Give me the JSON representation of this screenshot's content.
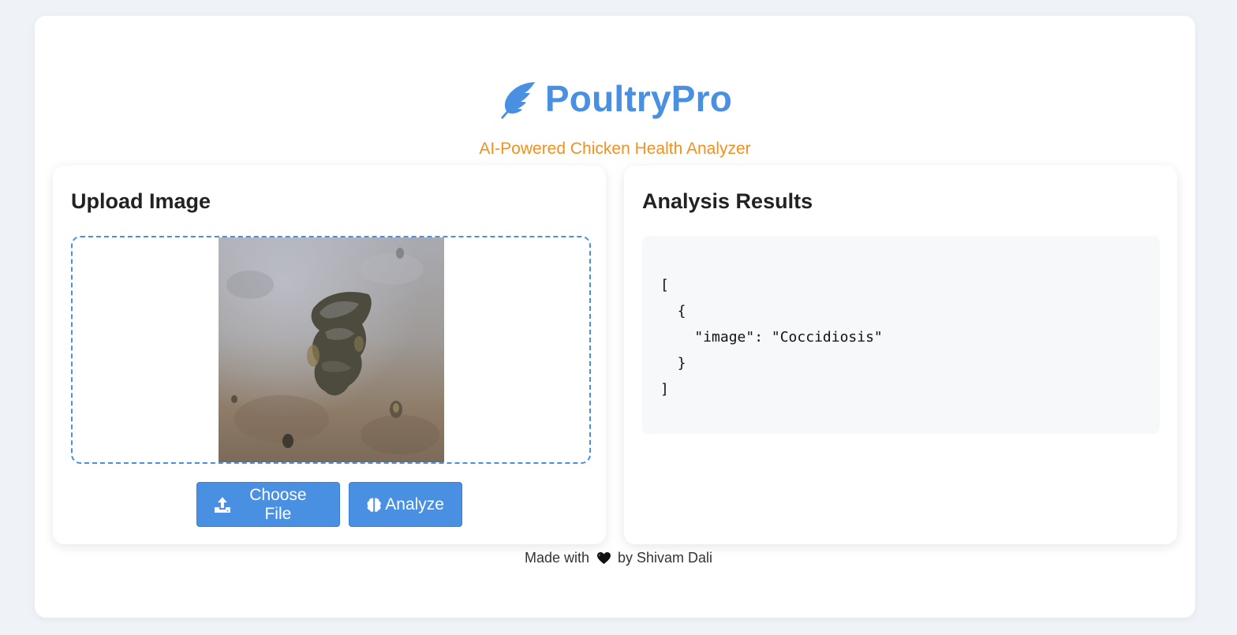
{
  "app": {
    "title": "PoultryPro",
    "subtitle": "AI-Powered Chicken Health Analyzer",
    "logo_icon": "feather-icon",
    "accent_color": "#4a90e2",
    "subtitle_color": "#f29020"
  },
  "upload_panel": {
    "title": "Upload Image",
    "preview_image_icon": "chicken-droppings-photo",
    "choose_button": {
      "label": "Choose File",
      "icon": "upload-icon"
    },
    "analyze_button": {
      "label": "Analyze",
      "icon": "brain-icon"
    }
  },
  "results_panel": {
    "title": "Analysis Results",
    "output": "[\n  {\n    \"image\": \"Coccidiosis\"\n  }\n]"
  },
  "footer": {
    "prefix": "Made with",
    "icon": "heart-icon",
    "suffix": "by Shivam Dali"
  }
}
